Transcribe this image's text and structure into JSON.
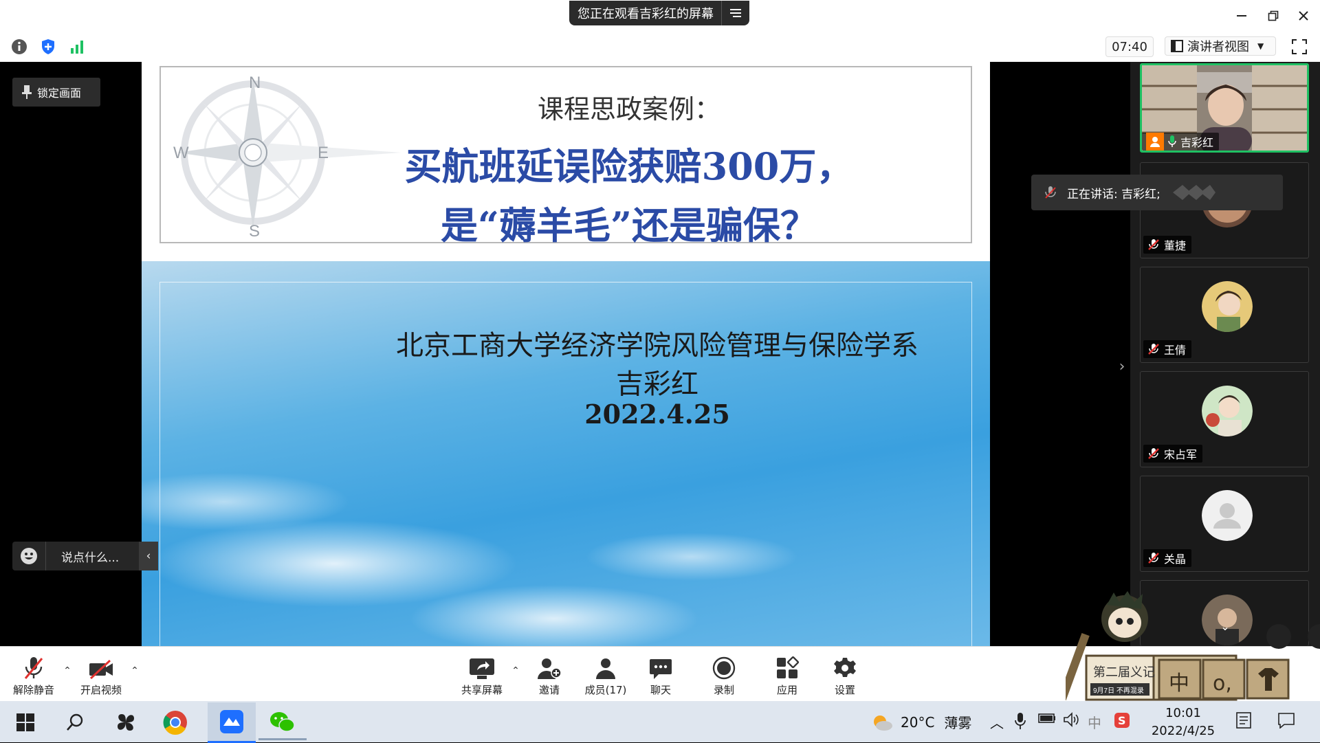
{
  "window": {
    "share_banner": "您正在观看吉彩红的屏幕"
  },
  "toolbar": {
    "timer": "07:40",
    "view_mode": "演讲者视图"
  },
  "stage": {
    "lock_screen": "锁定画面",
    "chat_placeholder": "说点什么...",
    "speaking_popup": "正在讲话: 吉彩红;"
  },
  "slide": {
    "subtitle": "课程思政案例：",
    "title_line1": "买航班延误险获赔300万，",
    "title_line2": "是“薅羊毛”还是骗保？",
    "compass_letters": {
      "n": "N",
      "s": "S",
      "w": "W",
      "e": "E"
    },
    "institution": "北京工商大学经济学院风险管理与保险学系",
    "author": "吉彩红",
    "date": "2022.4.25"
  },
  "participants": [
    {
      "name": "吉彩红",
      "state": "host-speaking"
    },
    {
      "name": "董捷",
      "state": "muted"
    },
    {
      "name": "王倩",
      "state": "muted"
    },
    {
      "name": "宋占军",
      "state": "muted"
    },
    {
      "name": "关晶",
      "state": "muted"
    }
  ],
  "controls": {
    "unmute": "解除静音",
    "start_video": "开启视频",
    "share_screen": "共享屏幕",
    "invite": "邀请",
    "members": "成员(17)",
    "chat": "聊天",
    "record": "录制",
    "apps": "应用",
    "settings": "设置"
  },
  "taskbar": {
    "weather_temp": "20°C",
    "weather_desc": "薄雾",
    "ime": "中",
    "time": "10:01",
    "date": "2022/4/25"
  },
  "sticker": {
    "sign_text": "第二届义记",
    "sign_sub": "9月7日 不再混录",
    "box1": "中",
    "box2": "o,"
  },
  "colors": {
    "accent_blue": "#2b4ba6",
    "speaking_green": "#1fc163",
    "muted_red": "#e0322f",
    "tencent_blue": "#1e6fff"
  }
}
